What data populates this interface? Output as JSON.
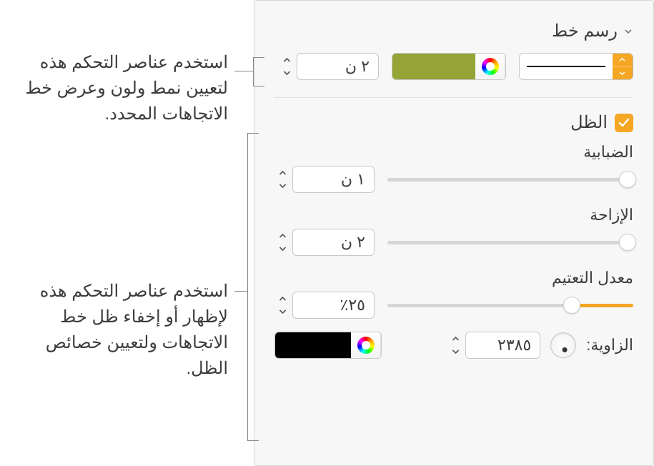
{
  "section": {
    "title": "رسم خط"
  },
  "stroke": {
    "width_value": "٢ ن",
    "color_hex": "#94a436"
  },
  "shadow": {
    "checkbox_label": "الظل",
    "blur_label": "الضبابية",
    "blur_value": "١ ن",
    "blur_fill_pct": 2,
    "blur_thumb_pct": 0,
    "offset_label": "الإزاحة",
    "offset_value": "٢ ن",
    "offset_fill_pct": 5,
    "offset_thumb_pct": 0,
    "opacity_label": "معدل التعتيم",
    "opacity_value": "٢٥٪",
    "opacity_fill_pct": 25,
    "opacity_thumb_pct": 20,
    "angle_label": "الزاوية:",
    "angle_value": "٢٣٨٥",
    "color_hex": "#000000"
  },
  "callouts": {
    "c1": "استخدم عناصر التحكم هذه لتعيين نمط ولون وعرض خط الاتجاهات المحدد.",
    "c2": "استخدم عناصر التحكم هذه لإظهار أو إخفاء ظل خط الاتجاهات ولتعيين خصائص الظل."
  }
}
